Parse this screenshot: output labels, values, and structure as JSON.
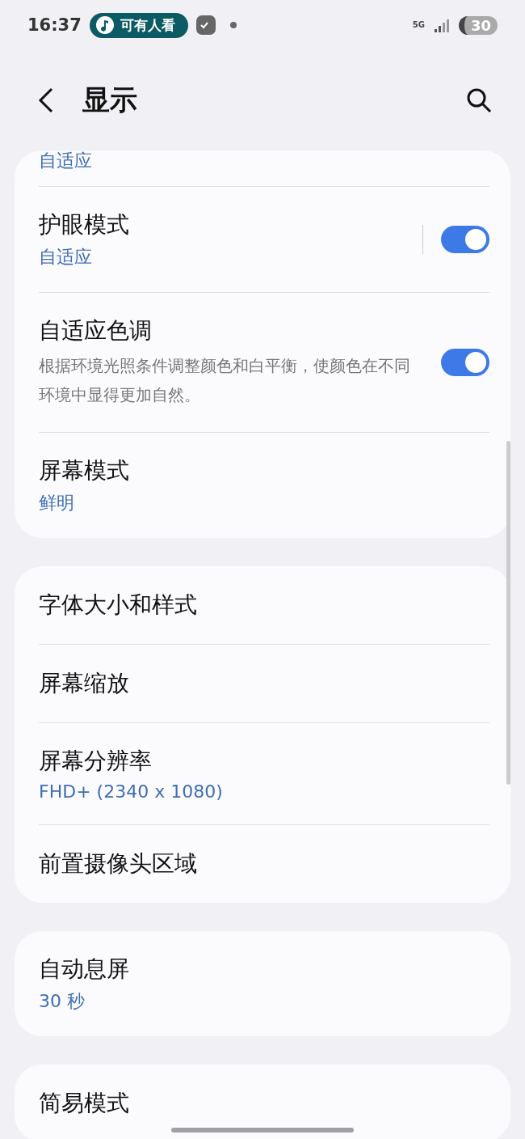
{
  "status_bar": {
    "time": "16:37",
    "notification": "可有人看",
    "network": "5G",
    "battery": "30"
  },
  "header": {
    "title": "显示"
  },
  "groups": [
    {
      "partial_subtitle": "自适应",
      "items": [
        {
          "title": "护眼模式",
          "subtitle": "自适应",
          "toggle": {
            "on": true
          },
          "separator": true
        },
        {
          "title": "自适应色调",
          "description": "根据环境光照条件调整颜色和白平衡，使颜色在不同环境中显得更加自然。",
          "toggle": {
            "on": true
          }
        },
        {
          "title": "屏幕模式",
          "subtitle": "鲜明"
        }
      ]
    },
    {
      "items": [
        {
          "title": "字体大小和样式"
        },
        {
          "title": "屏幕缩放"
        },
        {
          "title": "屏幕分辨率",
          "subtitle": "FHD+ (2340 x 1080)"
        },
        {
          "title": "前置摄像头区域"
        }
      ]
    },
    {
      "items": [
        {
          "title": "自动息屏",
          "subtitle": "30 秒"
        }
      ]
    },
    {
      "items": [
        {
          "title": "简易模式"
        }
      ]
    }
  ]
}
